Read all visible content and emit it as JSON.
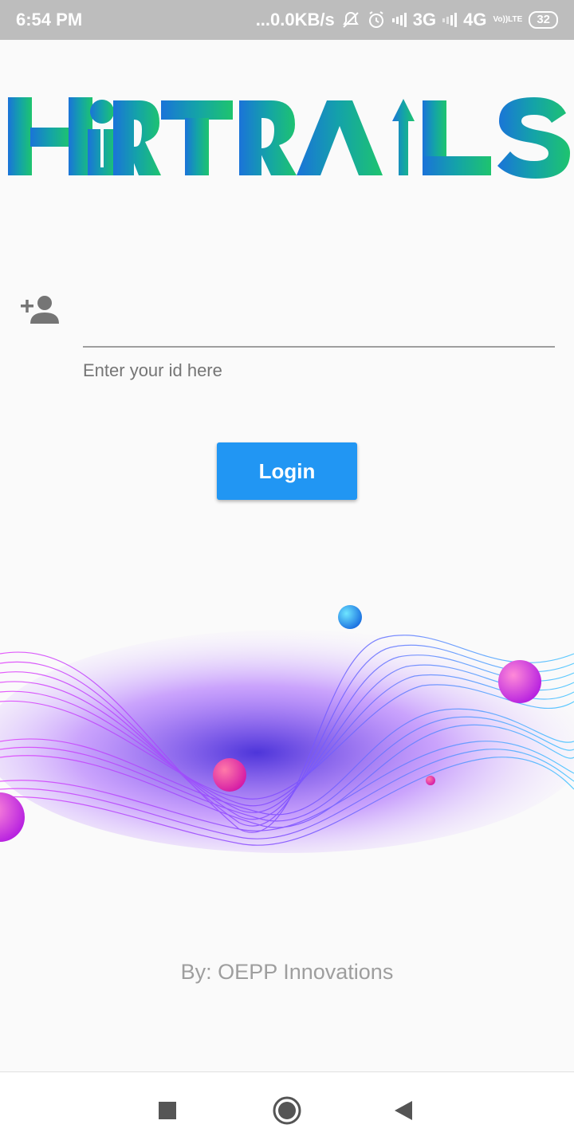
{
  "status_bar": {
    "time": "6:54 PM",
    "network_speed": "...0.0KB/s",
    "network_1": "3G",
    "network_2": "4G",
    "volte_line1": "Vo))",
    "volte_line2": "LTE",
    "battery": "32",
    "icons": [
      "mute-notifications-icon",
      "alarm-icon",
      "signal-icon",
      "signal-icon",
      "volte-icon",
      "battery-icon"
    ]
  },
  "logo": {
    "text": "HRTRAILS",
    "gradient_start": "#1a73d9",
    "gradient_end": "#1ec46e"
  },
  "login_form": {
    "icon": "add-user-icon",
    "input_value": "",
    "helper_text": "Enter your id here",
    "button_label": "Login",
    "button_color": "#2196f3"
  },
  "credit": "By: OEPP Innovations",
  "nav_bar": {
    "icons": [
      "recent-apps-icon",
      "home-icon",
      "back-icon"
    ]
  }
}
